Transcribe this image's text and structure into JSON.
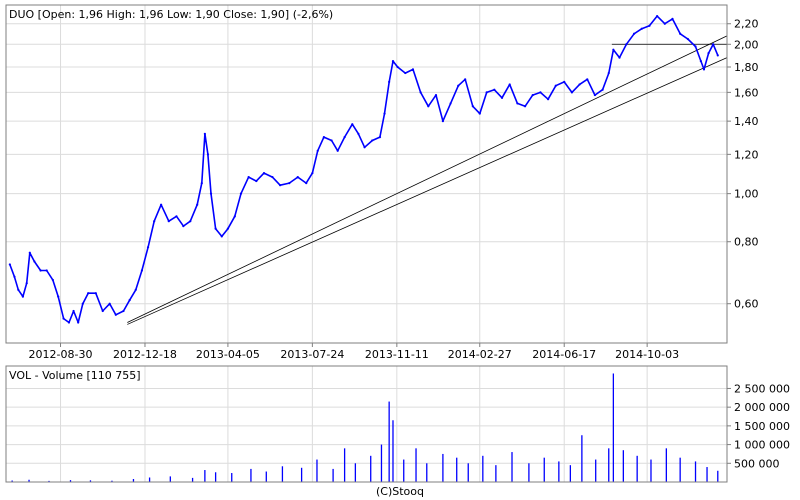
{
  "price_panel": {
    "title": "DUO [Open: 1,96 High: 1,96 Low: 1,90 Close: 1,90] (-2,6%)"
  },
  "volume_panel": {
    "title": "VOL - Volume [110 755]"
  },
  "footer": {
    "credit": "(C)Stooq"
  },
  "colors": {
    "series": "#0000ff",
    "grid": "#dcdcdc",
    "frame": "#7f7f7f",
    "trendline": "#000000"
  },
  "chart_data": [
    {
      "type": "line",
      "title": "DUO [Open: 1,96 High: 1,96 Low: 1,90 Close: 1,90] (-2,6%)",
      "y_scale": "log",
      "ylim": [
        0.5,
        2.4
      ],
      "y_ticks": [
        {
          "v": 0.6,
          "label": "0,60"
        },
        {
          "v": 0.8,
          "label": "0,80"
        },
        {
          "v": 1.0,
          "label": "1,00"
        },
        {
          "v": 1.2,
          "label": "1,20"
        },
        {
          "v": 1.4,
          "label": "1,40"
        },
        {
          "v": 1.6,
          "label": "1,60"
        },
        {
          "v": 1.8,
          "label": "1,80"
        },
        {
          "v": 2.0,
          "label": "2,00"
        },
        {
          "v": 2.2,
          "label": "2,20"
        }
      ],
      "xlim": [
        "2012-06-20",
        "2015-01-15"
      ],
      "x_ticks": [
        "2012-08-30",
        "2012-12-18",
        "2013-04-05",
        "2013-07-24",
        "2013-11-11",
        "2014-02-27",
        "2014-06-17",
        "2014-10-03"
      ],
      "grid": true,
      "series": [
        {
          "points": [
            [
              "2012-06-25",
              0.72
            ],
            [
              "2012-07-01",
              0.68
            ],
            [
              "2012-07-06",
              0.64
            ],
            [
              "2012-07-12",
              0.62
            ],
            [
              "2012-07-17",
              0.66
            ],
            [
              "2012-07-21",
              0.76
            ],
            [
              "2012-07-27",
              0.73
            ],
            [
              "2012-08-04",
              0.7
            ],
            [
              "2012-08-12",
              0.7
            ],
            [
              "2012-08-20",
              0.67
            ],
            [
              "2012-08-27",
              0.62
            ],
            [
              "2012-09-03",
              0.56
            ],
            [
              "2012-09-10",
              0.55
            ],
            [
              "2012-09-16",
              0.58
            ],
            [
              "2012-09-22",
              0.55
            ],
            [
              "2012-09-28",
              0.6
            ],
            [
              "2012-10-05",
              0.63
            ],
            [
              "2012-10-15",
              0.63
            ],
            [
              "2012-10-24",
              0.58
            ],
            [
              "2012-11-02",
              0.6
            ],
            [
              "2012-11-10",
              0.57
            ],
            [
              "2012-11-20",
              0.58
            ],
            [
              "2012-11-28",
              0.61
            ],
            [
              "2012-12-06",
              0.64
            ],
            [
              "2012-12-14",
              0.7
            ],
            [
              "2012-12-22",
              0.78
            ],
            [
              "2012-12-30",
              0.88
            ],
            [
              "2013-01-08",
              0.95
            ],
            [
              "2013-01-18",
              0.88
            ],
            [
              "2013-01-28",
              0.9
            ],
            [
              "2013-02-06",
              0.86
            ],
            [
              "2013-02-15",
              0.88
            ],
            [
              "2013-02-24",
              0.95
            ],
            [
              "2013-03-02",
              1.05
            ],
            [
              "2013-03-06",
              1.32
            ],
            [
              "2013-03-10",
              1.2
            ],
            [
              "2013-03-14",
              1.0
            ],
            [
              "2013-03-20",
              0.85
            ],
            [
              "2013-03-28",
              0.82
            ],
            [
              "2013-04-05",
              0.85
            ],
            [
              "2013-04-14",
              0.9
            ],
            [
              "2013-04-22",
              1.0
            ],
            [
              "2013-05-02",
              1.08
            ],
            [
              "2013-05-12",
              1.06
            ],
            [
              "2013-05-22",
              1.1
            ],
            [
              "2013-06-02",
              1.08
            ],
            [
              "2013-06-12",
              1.04
            ],
            [
              "2013-06-24",
              1.05
            ],
            [
              "2013-07-05",
              1.08
            ],
            [
              "2013-07-16",
              1.05
            ],
            [
              "2013-07-24",
              1.1
            ],
            [
              "2013-07-31",
              1.22
            ],
            [
              "2013-08-08",
              1.3
            ],
            [
              "2013-08-18",
              1.28
            ],
            [
              "2013-08-26",
              1.22
            ],
            [
              "2013-09-04",
              1.3
            ],
            [
              "2013-09-14",
              1.38
            ],
            [
              "2013-09-22",
              1.32
            ],
            [
              "2013-09-30",
              1.24
            ],
            [
              "2013-10-10",
              1.28
            ],
            [
              "2013-10-20",
              1.3
            ],
            [
              "2013-10-26",
              1.45
            ],
            [
              "2013-11-01",
              1.68
            ],
            [
              "2013-11-06",
              1.85
            ],
            [
              "2013-11-12",
              1.8
            ],
            [
              "2013-11-22",
              1.75
            ],
            [
              "2013-12-02",
              1.78
            ],
            [
              "2013-12-12",
              1.6
            ],
            [
              "2013-12-22",
              1.5
            ],
            [
              "2014-01-01",
              1.58
            ],
            [
              "2014-01-10",
              1.4
            ],
            [
              "2014-01-20",
              1.52
            ],
            [
              "2014-01-30",
              1.65
            ],
            [
              "2014-02-08",
              1.7
            ],
            [
              "2014-02-18",
              1.5
            ],
            [
              "2014-02-27",
              1.45
            ],
            [
              "2014-03-08",
              1.6
            ],
            [
              "2014-03-18",
              1.62
            ],
            [
              "2014-03-28",
              1.56
            ],
            [
              "2014-04-07",
              1.66
            ],
            [
              "2014-04-17",
              1.52
            ],
            [
              "2014-04-27",
              1.5
            ],
            [
              "2014-05-07",
              1.58
            ],
            [
              "2014-05-17",
              1.6
            ],
            [
              "2014-05-27",
              1.55
            ],
            [
              "2014-06-06",
              1.65
            ],
            [
              "2014-06-17",
              1.68
            ],
            [
              "2014-06-27",
              1.6
            ],
            [
              "2014-07-07",
              1.66
            ],
            [
              "2014-07-17",
              1.7
            ],
            [
              "2014-07-27",
              1.58
            ],
            [
              "2014-08-06",
              1.62
            ],
            [
              "2014-08-14",
              1.75
            ],
            [
              "2014-08-20",
              1.95
            ],
            [
              "2014-08-28",
              1.88
            ],
            [
              "2014-09-06",
              2.0
            ],
            [
              "2014-09-16",
              2.1
            ],
            [
              "2014-09-26",
              2.15
            ],
            [
              "2014-10-06",
              2.18
            ],
            [
              "2014-10-16",
              2.28
            ],
            [
              "2014-10-26",
              2.2
            ],
            [
              "2014-11-05",
              2.25
            ],
            [
              "2014-11-15",
              2.1
            ],
            [
              "2014-11-25",
              2.05
            ],
            [
              "2014-12-05",
              1.98
            ],
            [
              "2014-12-12",
              1.85
            ],
            [
              "2014-12-16",
              1.78
            ],
            [
              "2014-12-22",
              1.92
            ],
            [
              "2014-12-28",
              2.0
            ],
            [
              "2015-01-03",
              1.9
            ]
          ]
        }
      ],
      "trendlines": [
        {
          "from": [
            "2012-11-25",
            0.55
          ],
          "to": [
            "2015-01-15",
            2.08
          ]
        },
        {
          "from": [
            "2012-11-25",
            0.545
          ],
          "to": [
            "2015-01-15",
            1.88
          ]
        },
        {
          "from": [
            "2014-08-18",
            2.0
          ],
          "to": [
            "2015-01-15",
            2.0
          ]
        }
      ]
    },
    {
      "type": "bar",
      "title": "VOL - Volume [110 755]",
      "ylim": [
        0,
        3100000
      ],
      "y_ticks": [
        {
          "v": 500000,
          "label": "500 000"
        },
        {
          "v": 1000000,
          "label": "1 000 000"
        },
        {
          "v": 1500000,
          "label": "1 500 000"
        },
        {
          "v": 2000000,
          "label": "2 000 000"
        },
        {
          "v": 2500000,
          "label": "2 500 000"
        }
      ],
      "grid": true,
      "values": [
        [
          "2012-06-28",
          40000
        ],
        [
          "2012-07-20",
          60000
        ],
        [
          "2012-08-15",
          30000
        ],
        [
          "2012-09-12",
          50000
        ],
        [
          "2012-10-08",
          45000
        ],
        [
          "2012-11-05",
          35000
        ],
        [
          "2012-12-03",
          80000
        ],
        [
          "2012-12-24",
          120000
        ],
        [
          "2013-01-20",
          150000
        ],
        [
          "2013-02-18",
          110000
        ],
        [
          "2013-03-06",
          320000
        ],
        [
          "2013-03-20",
          260000
        ],
        [
          "2013-04-10",
          240000
        ],
        [
          "2013-05-05",
          350000
        ],
        [
          "2013-05-25",
          280000
        ],
        [
          "2013-06-15",
          420000
        ],
        [
          "2013-07-10",
          380000
        ],
        [
          "2013-07-30",
          600000
        ],
        [
          "2013-08-20",
          350000
        ],
        [
          "2013-09-04",
          900000
        ],
        [
          "2013-09-18",
          500000
        ],
        [
          "2013-10-08",
          700000
        ],
        [
          "2013-10-22",
          1000000
        ],
        [
          "2013-11-01",
          2150000
        ],
        [
          "2013-11-06",
          1650000
        ],
        [
          "2013-11-20",
          600000
        ],
        [
          "2013-12-06",
          900000
        ],
        [
          "2013-12-20",
          500000
        ],
        [
          "2014-01-10",
          750000
        ],
        [
          "2014-01-28",
          650000
        ],
        [
          "2014-02-12",
          500000
        ],
        [
          "2014-03-03",
          700000
        ],
        [
          "2014-03-20",
          450000
        ],
        [
          "2014-04-10",
          800000
        ],
        [
          "2014-05-02",
          500000
        ],
        [
          "2014-05-22",
          650000
        ],
        [
          "2014-06-10",
          550000
        ],
        [
          "2014-06-25",
          450000
        ],
        [
          "2014-07-10",
          1250000
        ],
        [
          "2014-07-28",
          600000
        ],
        [
          "2014-08-14",
          900000
        ],
        [
          "2014-08-20",
          2900000
        ],
        [
          "2014-09-02",
          850000
        ],
        [
          "2014-09-20",
          700000
        ],
        [
          "2014-10-08",
          600000
        ],
        [
          "2014-10-28",
          900000
        ],
        [
          "2014-11-15",
          650000
        ],
        [
          "2014-12-05",
          550000
        ],
        [
          "2014-12-20",
          400000
        ],
        [
          "2015-01-03",
          300000
        ]
      ]
    }
  ]
}
